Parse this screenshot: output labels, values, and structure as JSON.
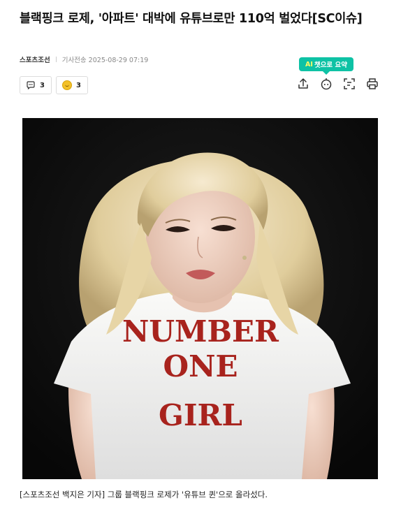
{
  "article": {
    "headline": "블랙핑크 로제, '아파트' 대박에 유튜브로만 110억 벌었다[SC이슈]",
    "press": "스포츠조선",
    "date_label": "기사전송 2025-08-29 07:19"
  },
  "ai_summary": {
    "ai": "AI",
    "label": "챗으로 요약"
  },
  "reactions": {
    "comments_count": "3",
    "likes_count": "3"
  },
  "toolbar": {
    "icons": [
      "share-icon",
      "ai-chat-icon",
      "summary-icon",
      "print-icon"
    ]
  },
  "photo": {
    "shirt_text": [
      "NUMBER",
      "ONE",
      "GIRL"
    ],
    "colors": {
      "background": "#0b0b0b",
      "hair": "#e8d7a8",
      "skin": "#f0d2c2",
      "shirt": "#f3f3f1",
      "lettering": "#a8231d"
    }
  },
  "caption": "[스포츠조선 백지은 기자] 그룹 블랙핑크 로제가 '유튜브 퀸'으로 올라섰다.",
  "colors": {
    "accent": "#0ec2a5",
    "accent_text": "#fffa66"
  }
}
